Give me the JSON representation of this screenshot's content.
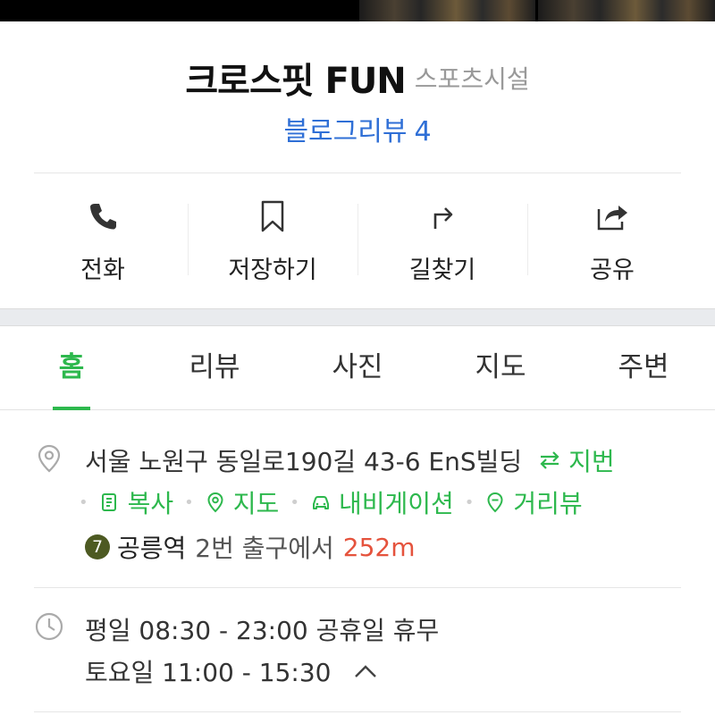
{
  "place": {
    "name": "크로스핏 FUN",
    "category": "스포츠시설",
    "blog_label": "블로그리뷰",
    "blog_count": "4"
  },
  "actions": [
    {
      "label": "전화",
      "icon": "phone-icon"
    },
    {
      "label": "저장하기",
      "icon": "bookmark-icon"
    },
    {
      "label": "길찾기",
      "icon": "directions-icon"
    },
    {
      "label": "공유",
      "icon": "share-icon"
    }
  ],
  "tabs": [
    {
      "label": "홈",
      "active": true
    },
    {
      "label": "리뷰",
      "active": false
    },
    {
      "label": "사진",
      "active": false
    },
    {
      "label": "지도",
      "active": false
    },
    {
      "label": "주변",
      "active": false
    }
  ],
  "address": {
    "text": "서울 노원구 동일로190길 43-6 EnS빌딩",
    "jibun_label": "지번",
    "copy_label": "복사",
    "map_label": "지도",
    "navi_label": "내비게이션",
    "streetview_label": "거리뷰",
    "subway_line": "7",
    "station": "공릉역",
    "exit_text": "2번 출구에서",
    "distance": "252m"
  },
  "hours": {
    "weekday": "평일 08:30 - 23:00 공휴일 휴무",
    "saturday": "토요일 11:00 - 15:30"
  },
  "colors": {
    "accent": "#2db84d",
    "link": "#2f6fd6",
    "distance": "#e5533d",
    "subway_line7": "#4d5a22"
  }
}
